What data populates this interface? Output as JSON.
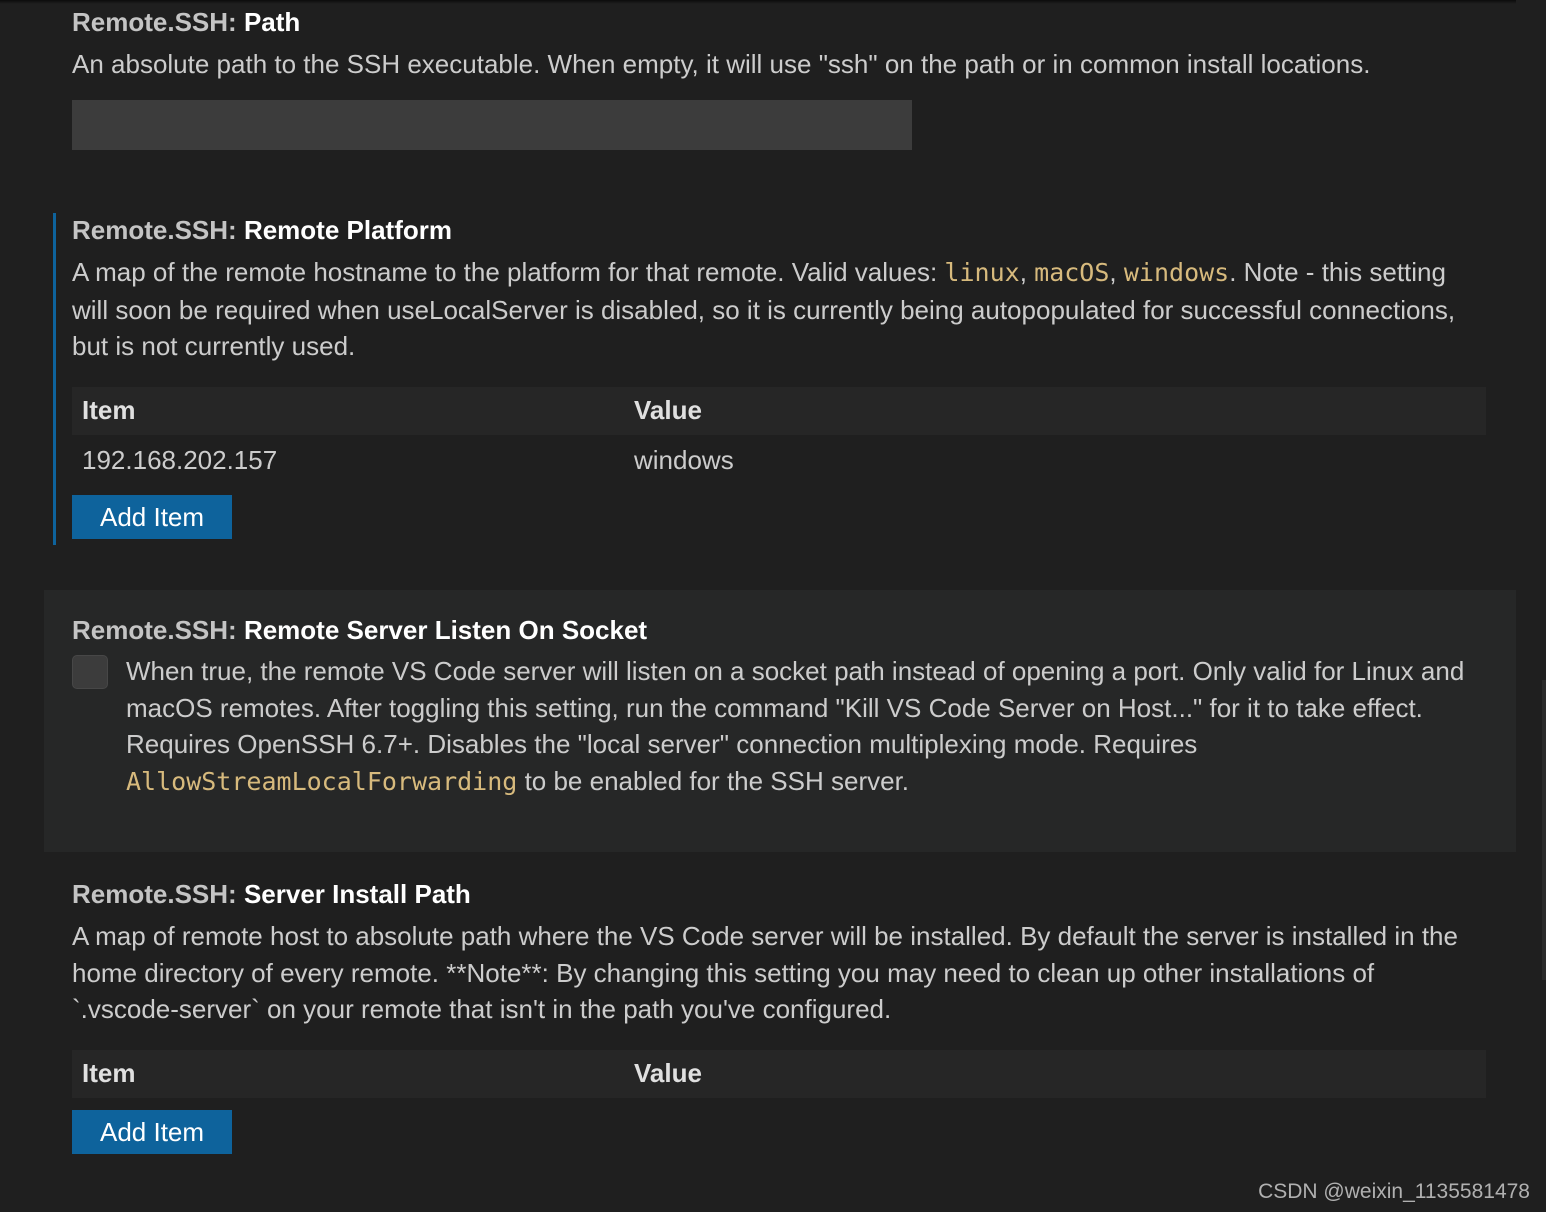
{
  "settings": {
    "path": {
      "category": "Remote.SSH:",
      "name": "Path",
      "description": "An absolute path to the SSH executable. When empty, it will use \"ssh\" on the path or in common install locations.",
      "value": ""
    },
    "remote_platform": {
      "category": "Remote.SSH:",
      "name": "Remote Platform",
      "desc_part1": "A map of the remote hostname to the platform for that remote. Valid values: ",
      "code1": "linux",
      "sep1": ", ",
      "code2": "macOS",
      "sep2": ", ",
      "code3": "windows",
      "desc_part2": ". Note - this setting will soon be required when useLocalServer is disabled, so it is currently being autopopulated for successful connections, but is not currently used.",
      "table": {
        "header_item": "Item",
        "header_value": "Value",
        "rows": [
          {
            "item": "192.168.202.157",
            "value": "windows"
          }
        ]
      },
      "add_button": "Add Item"
    },
    "listen_on_socket": {
      "category": "Remote.SSH:",
      "name": "Remote Server Listen On Socket",
      "checked": false,
      "desc_part1": "When true, the remote VS Code server will listen on a socket path instead of opening a port. Only valid for Linux and macOS remotes. After toggling this setting, run the command \"Kill VS Code Server on Host...\" for it to take effect. Requires OpenSSH 6.7+. Disables the \"local server\" connection multiplexing mode. Requires ",
      "code": "AllowStreamLocalForwarding",
      "desc_part2": " to be enabled for the SSH server."
    },
    "server_install_path": {
      "category": "Remote.SSH:",
      "name": "Server Install Path",
      "description": "A map of remote host to absolute path where the VS Code server will be installed. By default the server is installed in the home directory of every remote. **Note**: By changing this setting you may need to clean up other installations of `.vscode-server` on your remote that isn't in the path you've configured.",
      "table": {
        "header_item": "Item",
        "header_value": "Value",
        "rows": []
      },
      "add_button": "Add Item"
    }
  },
  "watermark": "CSDN @weixin_1135581478",
  "colors": {
    "background": "#1f1f1f",
    "code": "#d7ba7d",
    "button": "#0e639c",
    "focus_bar": "#0e639c"
  }
}
